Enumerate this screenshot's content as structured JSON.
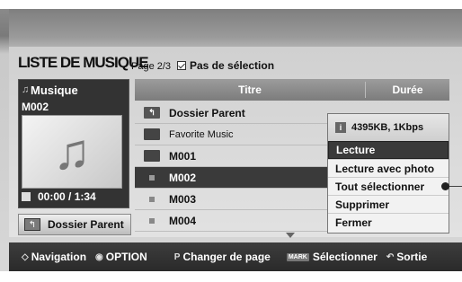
{
  "header": {
    "title": "LISTE DE MUSIQUE",
    "page_info": "Page 2/3",
    "selection_status": "Pas de sélection"
  },
  "left_panel": {
    "category_label": "Musique",
    "current_file": "M002",
    "time": "00:00 / 1:34",
    "parent_button": "Dossier Parent"
  },
  "list": {
    "columns": [
      "Titre",
      "Durée"
    ],
    "rows": [
      {
        "type": "folder-up",
        "name": "Dossier Parent"
      },
      {
        "type": "folder",
        "name": "Favorite Music"
      },
      {
        "type": "folder",
        "name": "M001"
      },
      {
        "type": "file",
        "name": "M002",
        "selected": true
      },
      {
        "type": "file",
        "name": "M003"
      },
      {
        "type": "file",
        "name": "M004"
      }
    ]
  },
  "popup": {
    "info": "4395KB, 1Kbps",
    "items": [
      "Lecture",
      "Lecture avec photo",
      "Tout sélectionner",
      "Supprimer",
      "Fermer"
    ],
    "active_index": 0
  },
  "bottom_bar": {
    "navigation": "Navigation",
    "option": "OPTION",
    "change_page": "Changer de page",
    "mark_key": "MARK",
    "select": "Sélectionner",
    "exit": "Sortie"
  },
  "icons": {
    "music": "music-note-icon",
    "folder": "folder-icon",
    "info": "info-icon"
  }
}
